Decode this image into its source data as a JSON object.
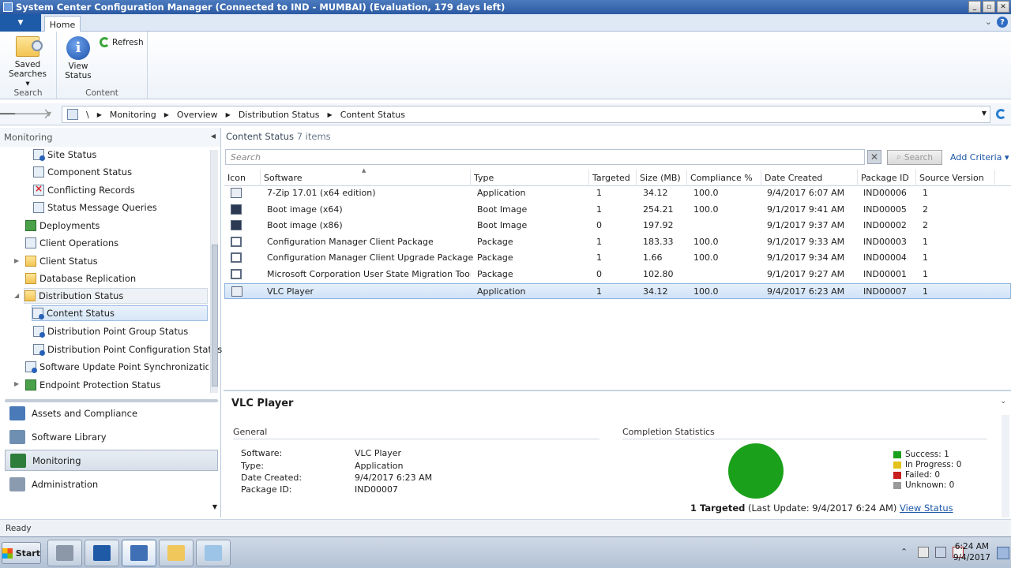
{
  "window": {
    "title": "System Center Configuration Manager (Connected to IND - MUMBAI) (Evaluation, 179 days left)",
    "min": "_",
    "restore": "▫",
    "close": "✕"
  },
  "ribbon": {
    "app_menu_glyph": "▼",
    "tab_home": "Home",
    "help": "?",
    "groups": [
      {
        "label": "Search",
        "buttons": [
          {
            "label_line1": "Saved",
            "label_line2": "Searches ▾",
            "icon": "folder-search-icon"
          }
        ]
      },
      {
        "label": "Content",
        "buttons": [
          {
            "label_line1": "View",
            "label_line2": "Status",
            "icon": "info-icon"
          },
          {
            "label": "Refresh",
            "icon": "refresh-icon"
          }
        ]
      }
    ]
  },
  "address": {
    "root": "\\",
    "crumbs": [
      "Monitoring",
      "Overview",
      "Distribution Status",
      "Content Status"
    ],
    "sep": "▶"
  },
  "nav": {
    "header": "Monitoring",
    "collapse": "◀",
    "tree": [
      {
        "label": "Site Status",
        "icon": "site-status-icon"
      },
      {
        "label": "Component Status",
        "icon": "component-status-icon"
      },
      {
        "label": "Conflicting Records",
        "icon": "conflicting-records-icon"
      },
      {
        "label": "Status Message Queries",
        "icon": "status-query-icon"
      },
      {
        "label": "Deployments",
        "icon": "deployments-icon"
      },
      {
        "label": "Client Operations",
        "icon": "client-operations-icon"
      },
      {
        "label": "Client Status",
        "icon": "folder-icon"
      },
      {
        "label": "Database Replication",
        "icon": "database-replication-icon"
      },
      {
        "label": "Distribution Status",
        "icon": "folder-icon"
      },
      {
        "label": "Content Status",
        "icon": "content-status-icon"
      },
      {
        "label": "Distribution Point Group Status",
        "icon": "dp-group-icon"
      },
      {
        "label": "Distribution Point Configuration Status",
        "icon": "dp-config-icon"
      },
      {
        "label": "Software Update Point Synchronization Status",
        "icon": "sup-sync-icon"
      },
      {
        "label": "Endpoint Protection Status",
        "icon": "endpoint-protection-icon"
      }
    ],
    "workspaces": [
      {
        "label": "Assets and Compliance",
        "color": "#4a7ab8"
      },
      {
        "label": "Software Library",
        "color": "#6f8fb2"
      },
      {
        "label": "Monitoring",
        "color": "#2e7d3a"
      },
      {
        "label": "Administration",
        "color": "#8a9bb0"
      }
    ]
  },
  "content": {
    "title": "Content Status",
    "count": "7 items",
    "search_placeholder": "Search",
    "search_button": "Search",
    "add_criteria": "Add Criteria ▾",
    "columns": [
      "Icon",
      "Software",
      "Type",
      "Targeted",
      "Size (MB)",
      "Compliance %",
      "Date Created",
      "Package ID",
      "Source Version"
    ],
    "rows": [
      {
        "icon": "application",
        "software": "7-Zip 17.01 (x64 edition)",
        "type": "Application",
        "targeted": "1",
        "size": "34.12",
        "compliance": "100.0",
        "date": "9/4/2017 6:07 AM",
        "package_id": "IND00006",
        "source_version": "1"
      },
      {
        "icon": "boot",
        "software": "Boot image (x64)",
        "type": "Boot Image",
        "targeted": "1",
        "size": "254.21",
        "compliance": "100.0",
        "date": "9/1/2017 9:41 AM",
        "package_id": "IND00005",
        "source_version": "2"
      },
      {
        "icon": "boot",
        "software": "Boot image (x86)",
        "type": "Boot Image",
        "targeted": "0",
        "size": "197.92",
        "compliance": "",
        "date": "9/1/2017 9:37 AM",
        "package_id": "IND00002",
        "source_version": "2"
      },
      {
        "icon": "package",
        "software": "Configuration Manager Client Package",
        "type": "Package",
        "targeted": "1",
        "size": "183.33",
        "compliance": "100.0",
        "date": "9/1/2017 9:33 AM",
        "package_id": "IND00003",
        "source_version": "1"
      },
      {
        "icon": "package",
        "software": "Configuration Manager Client Upgrade Package",
        "type": "Package",
        "targeted": "1",
        "size": "1.66",
        "compliance": "100.0",
        "date": "9/1/2017 9:34 AM",
        "package_id": "IND00004",
        "source_version": "1"
      },
      {
        "icon": "package",
        "software": "Microsoft Corporation User State Migration Tool for Wi...",
        "type": "Package",
        "targeted": "0",
        "size": "102.80",
        "compliance": "",
        "date": "9/1/2017 9:27 AM",
        "package_id": "IND00001",
        "source_version": "1"
      },
      {
        "icon": "application",
        "software": "VLC Player",
        "type": "Application",
        "targeted": "1",
        "size": "34.12",
        "compliance": "100.0",
        "date": "9/4/2017 6:23 AM",
        "package_id": "IND00007",
        "source_version": "1"
      }
    ]
  },
  "detail": {
    "title": "VLC Player",
    "general_label": "General",
    "completion_label": "Completion Statistics",
    "fields": [
      {
        "key": "Software:",
        "value": "VLC Player"
      },
      {
        "key": "Type:",
        "value": "Application"
      },
      {
        "key": "Date Created:",
        "value": "9/4/2017 6:23 AM"
      },
      {
        "key": "Package ID:",
        "value": "IND00007"
      }
    ],
    "legend": [
      {
        "label": "Success: 1",
        "color": "#1aa01a"
      },
      {
        "label": "In Progress: 0",
        "color": "#e3c21b"
      },
      {
        "label": "Failed: 0",
        "color": "#c81e1e"
      },
      {
        "label": "Unknown: 0",
        "color": "#9a9a9a"
      }
    ],
    "pie_success_fraction": 1.0,
    "targeted_bold": "1 Targeted",
    "targeted_rest": " (Last Update: 9/4/2017 6:24 AM) ",
    "view_status_link": "View Status"
  },
  "status_bar": {
    "text": "Ready"
  },
  "taskbar": {
    "start": "Start",
    "clock_time": "6:24 AM",
    "clock_date": "9/4/2017",
    "tray_up": "⌃"
  }
}
